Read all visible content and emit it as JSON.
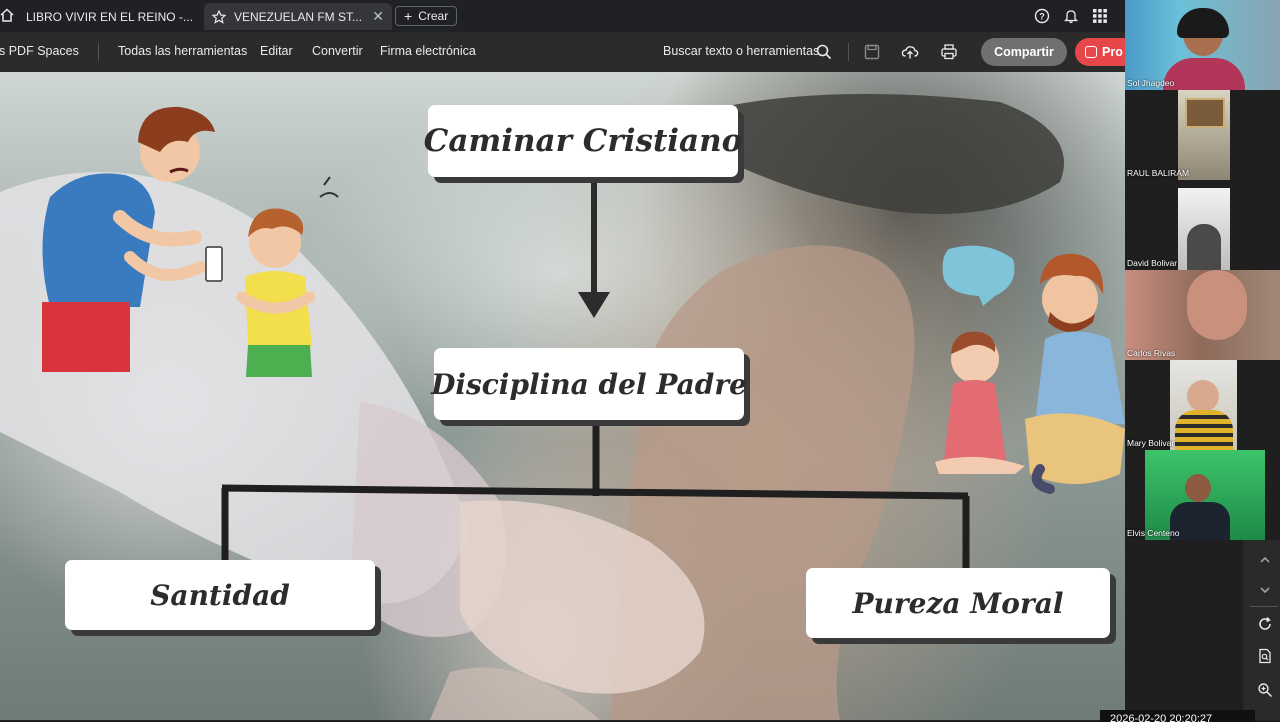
{
  "browser": {
    "tabs": [
      {
        "label": "LIBRO VIVIR EN EL REINO -...",
        "active": false
      },
      {
        "label": "VENEZUELAN FM ST...",
        "active": true
      }
    ],
    "new_tab_label": "Crear"
  },
  "toolbar": {
    "items": [
      "s PDF Spaces",
      "Todas las herramientas",
      "Editar",
      "Convertir",
      "Firma electrónica"
    ],
    "search_label": "Buscar texto o herramientas",
    "share_label": "Compartir",
    "pro_label": "Pro"
  },
  "slide": {
    "title": "Caminar Cristiano",
    "middle": "Disciplina del Padre",
    "left": "Santidad",
    "right": "Pureza Moral"
  },
  "participants": [
    {
      "name": "Sol Jhagdeo"
    },
    {
      "name": "RAUL BALIRAM"
    },
    {
      "name": "David Bolivar"
    },
    {
      "name": "Carlos Rivas"
    },
    {
      "name": "Mary Bolivar"
    },
    {
      "name": "Elvis Centeno"
    }
  ],
  "clock": "2026-02-20 20:20:27",
  "colors": {
    "accent_share": "#707070",
    "accent_pro": "#e8474a",
    "box_shadow": "#3a3a3a"
  }
}
